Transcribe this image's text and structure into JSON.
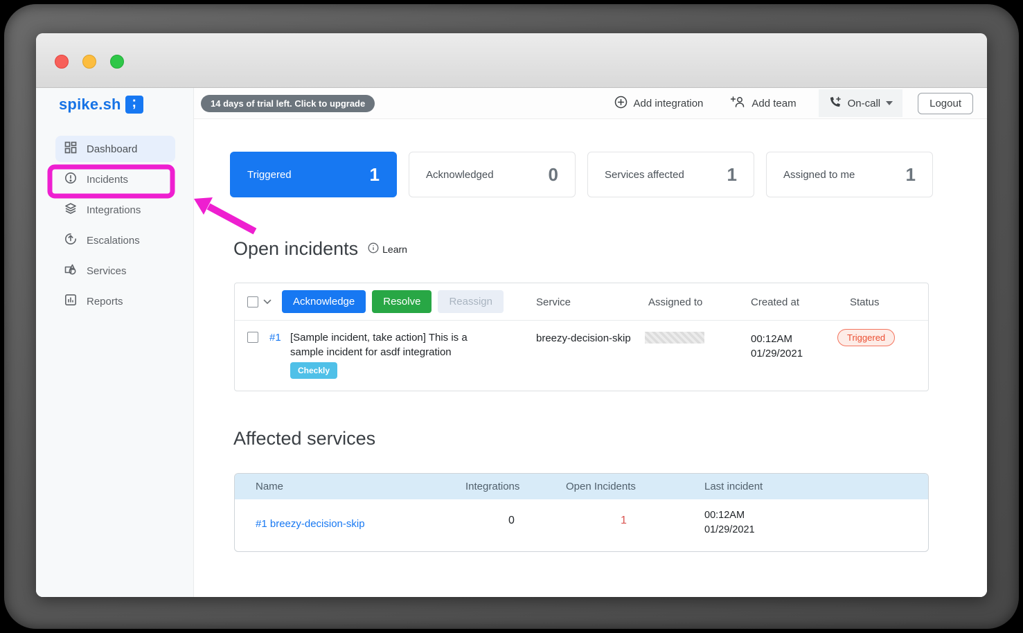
{
  "brand": {
    "name": "spike.sh",
    "logo_glyph": ";"
  },
  "sidebar": {
    "items": [
      {
        "label": "Dashboard",
        "icon": "dashboard-grid-icon",
        "active": true
      },
      {
        "label": "Incidents",
        "icon": "incident-alert-icon",
        "highlighted": true
      },
      {
        "label": "Integrations",
        "icon": "layers-icon"
      },
      {
        "label": "Escalations",
        "icon": "arrow-up-circle-icon"
      },
      {
        "label": "Services",
        "icon": "shapes-icon"
      },
      {
        "label": "Reports",
        "icon": "bar-chart-icon"
      }
    ]
  },
  "topbar": {
    "trial_badge": "14 days of trial left. Click to upgrade",
    "add_integration": "Add integration",
    "add_team": "Add team",
    "on_call": "On-call",
    "logout": "Logout"
  },
  "stats": [
    {
      "label": "Triggered",
      "value": "1",
      "active": true
    },
    {
      "label": "Acknowledged",
      "value": "0"
    },
    {
      "label": "Services affected",
      "value": "1"
    },
    {
      "label": "Assigned to me",
      "value": "1"
    }
  ],
  "open_incidents": {
    "title": "Open incidents",
    "learn_label": "Learn",
    "actions": {
      "acknowledge": "Acknowledge",
      "resolve": "Resolve",
      "reassign": "Reassign"
    },
    "columns": [
      "Service",
      "Assigned to",
      "Created at",
      "Status"
    ],
    "row": {
      "id": "#1",
      "description": "[Sample incident, take action] This is a sample incident for asdf integration",
      "integration_badge": "Checkly",
      "service": "breezy-decision-skip",
      "assigned_to_redacted": "",
      "created_time": "00:12AM",
      "created_date": "01/29/2021",
      "status": "Triggered"
    }
  },
  "affected_services": {
    "title": "Affected services",
    "columns": [
      "Name",
      "Integrations",
      "Open Incidents",
      "Last incident"
    ],
    "row": {
      "name": "#1 breezy-decision-skip",
      "integrations": "0",
      "open_incidents": "1",
      "last_time": "00:12AM",
      "last_date": "01/29/2021"
    }
  },
  "colors": {
    "brand_blue": "#1778f2",
    "resolve_green": "#28a745",
    "checkly_blue": "#4fc0e8",
    "status_triggered_text": "#ec4f33",
    "status_triggered_bg": "#fdece7",
    "annotation_magenta": "#ee1fd0",
    "trial_badge_gray": "#6c757d",
    "open_incident_red": "#d9534f",
    "traffic_red": "#f7605a",
    "traffic_yellow": "#fcbd3f",
    "traffic_green": "#2ec748"
  }
}
